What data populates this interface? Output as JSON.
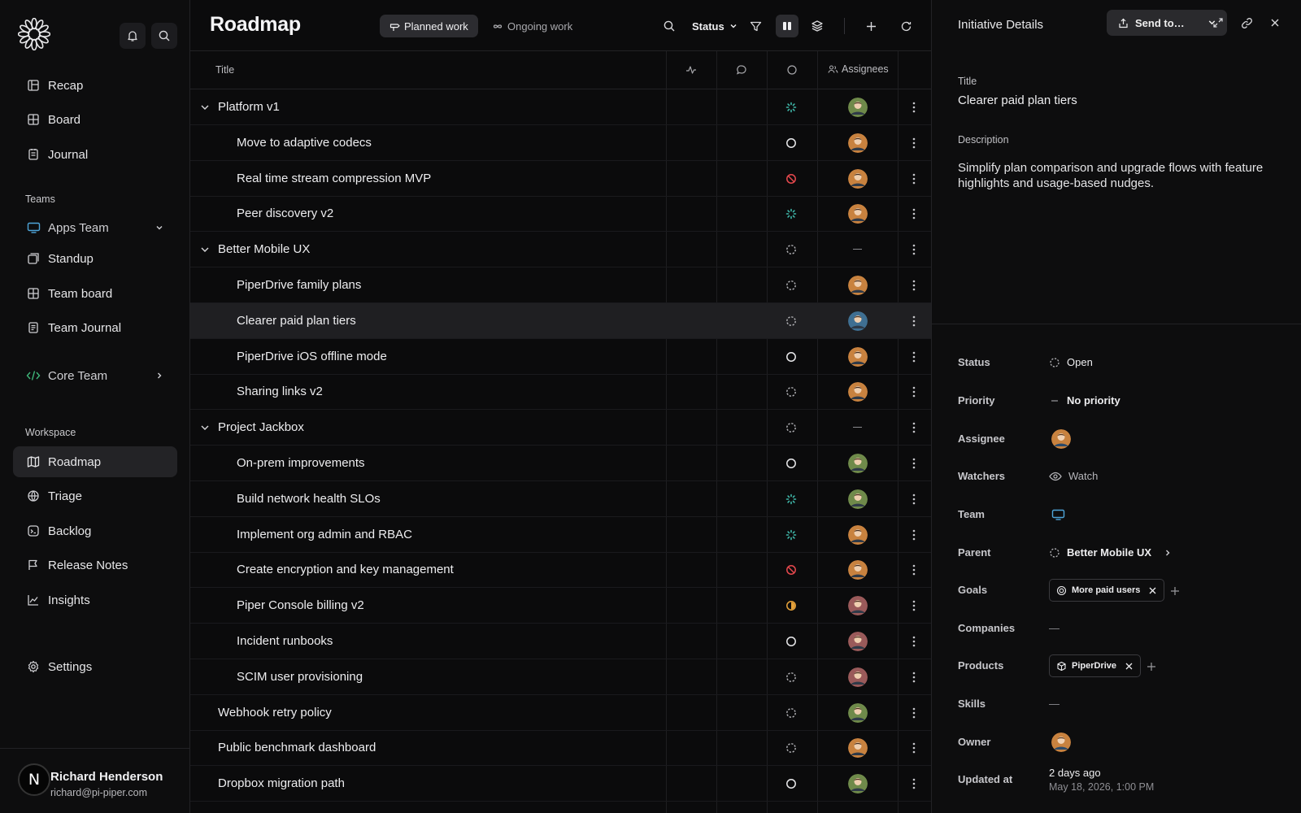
{
  "sidebar": {
    "nav": [
      "Recap",
      "Board",
      "Journal"
    ],
    "teams_label": "Teams",
    "apps_team": "Apps Team",
    "apps_items": [
      "Standup",
      "Team board",
      "Team Journal"
    ],
    "core_team": "Core Team",
    "workspace_label": "Workspace",
    "workspace_items": [
      "Roadmap",
      "Triage",
      "Backlog",
      "Release Notes",
      "Insights"
    ],
    "settings": "Settings",
    "user": {
      "initial": "N",
      "name": "Richard Henderson",
      "email": "richard@pi-piper.com"
    }
  },
  "main": {
    "title": "Roadmap",
    "tabs": [
      "Planned work",
      "Ongoing work"
    ],
    "status_filter": "Status",
    "columns": {
      "title": "Title",
      "assignees": "Assignees"
    },
    "rows": [
      {
        "title": "Platform v1",
        "status": "in-progress",
        "assignee": "green"
      },
      {
        "title": "Move to adaptive codecs",
        "status": "todo",
        "assignee": "orange"
      },
      {
        "title": "Real time stream compression MVP",
        "status": "blocked",
        "assignee": "orange"
      },
      {
        "title": "Peer discovery v2",
        "status": "in-progress",
        "assignee": "orange"
      },
      {
        "title": "Better Mobile UX",
        "status": "open",
        "assignee": ""
      },
      {
        "title": "PiperDrive family plans",
        "status": "open",
        "assignee": "orange"
      },
      {
        "title": "Clearer paid plan tiers",
        "status": "open",
        "assignee": "blue"
      },
      {
        "title": "PiperDrive iOS offline mode",
        "status": "todo",
        "assignee": "orange"
      },
      {
        "title": "Sharing links v2",
        "status": "open",
        "assignee": "orange"
      },
      {
        "title": "Project Jackbox",
        "status": "open",
        "assignee": ""
      },
      {
        "title": "On-prem improvements",
        "status": "todo",
        "assignee": "green"
      },
      {
        "title": "Build network health SLOs",
        "status": "in-progress",
        "assignee": "green"
      },
      {
        "title": "Implement org admin and RBAC",
        "status": "in-progress",
        "assignee": "orange"
      },
      {
        "title": "Create encryption and key management",
        "status": "blocked",
        "assignee": "orange"
      },
      {
        "title": "Piper Console billing v2",
        "status": "half",
        "assignee": "pink"
      },
      {
        "title": "Incident runbooks",
        "status": "todo",
        "assignee": "pink"
      },
      {
        "title": "SCIM user provisioning",
        "status": "open",
        "assignee": "pink"
      },
      {
        "title": "Webhook retry policy",
        "status": "open",
        "assignee": "green"
      },
      {
        "title": "Public benchmark dashboard",
        "status": "open",
        "assignee": "orange"
      },
      {
        "title": "Dropbox migration path",
        "status": "todo",
        "assignee": "green"
      }
    ]
  },
  "panel": {
    "header": "Initiative Details",
    "send": "Send to…",
    "title_label": "Title",
    "title": "Clearer paid plan tiers",
    "description_label": "Description",
    "description": "Simplify plan comparison and upgrade flows with feature highlights and usage-based nudges.",
    "labels": {
      "status": "Status",
      "priority": "Priority",
      "assignee": "Assignee",
      "watchers": "Watchers",
      "team": "Team",
      "parent": "Parent",
      "goals": "Goals",
      "companies": "Companies",
      "products": "Products",
      "skills": "Skills",
      "owner": "Owner",
      "updated": "Updated at"
    },
    "status": "Open",
    "priority": "No priority",
    "watch": "Watch",
    "parent": "Better Mobile UX",
    "goal": "More paid users",
    "companies": "—",
    "product": "PiperDrive",
    "skills": "—",
    "updated_rel": "2 days ago",
    "updated_abs": "May 18, 2026, 1:00 PM"
  },
  "colors": {
    "accent_teal": "#3fb6a8",
    "blocked_red": "#e5484d",
    "half_amber": "#e5a13a",
    "team_blue": "#4ea5d9"
  }
}
